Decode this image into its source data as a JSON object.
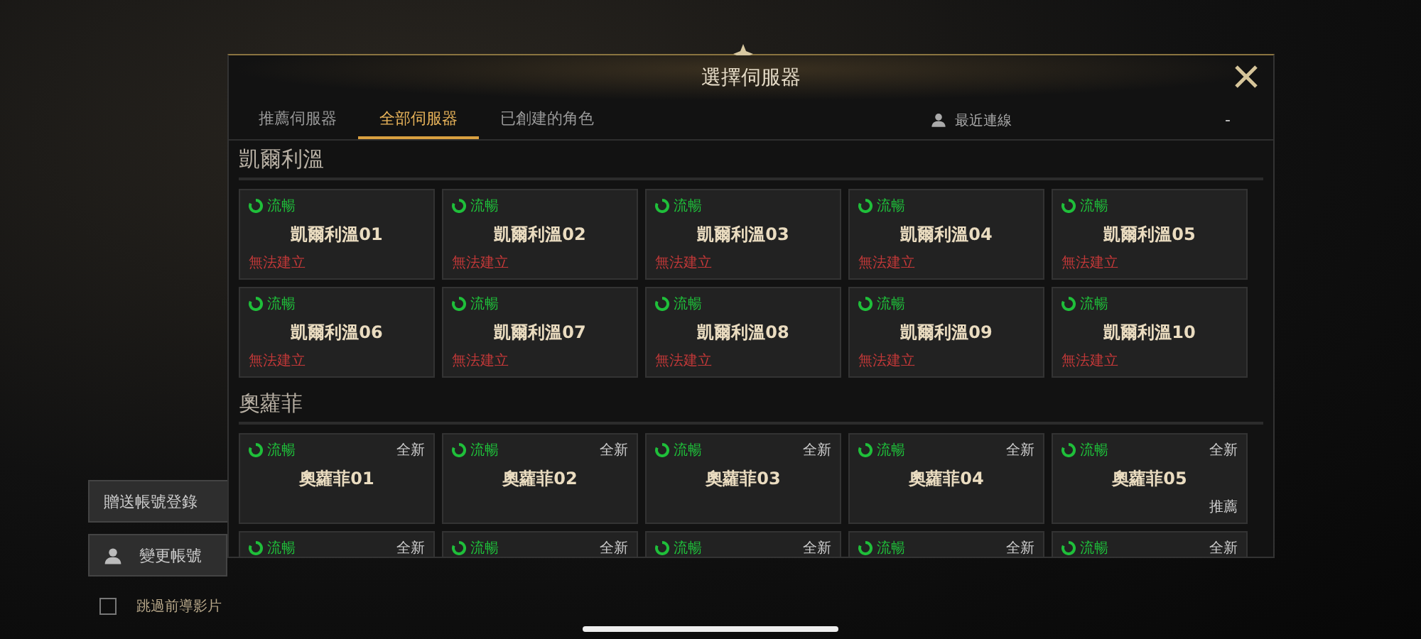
{
  "dialog": {
    "title": "選擇伺服器"
  },
  "tabs": [
    {
      "label": "推薦伺服器",
      "selected": false
    },
    {
      "label": "全部伺服器",
      "selected": true
    },
    {
      "label": "已創建的角色",
      "selected": false
    }
  ],
  "recent": {
    "label": "最近連線",
    "value": "-"
  },
  "sections": [
    {
      "title": "凱爾利溫",
      "servers": [
        {
          "status": "流暢",
          "name": "凱爾利溫01",
          "note": "無法建立"
        },
        {
          "status": "流暢",
          "name": "凱爾利溫02",
          "note": "無法建立"
        },
        {
          "status": "流暢",
          "name": "凱爾利溫03",
          "note": "無法建立"
        },
        {
          "status": "流暢",
          "name": "凱爾利溫04",
          "note": "無法建立"
        },
        {
          "status": "流暢",
          "name": "凱爾利溫05",
          "note": "無法建立"
        },
        {
          "status": "流暢",
          "name": "凱爾利溫06",
          "note": "無法建立"
        },
        {
          "status": "流暢",
          "name": "凱爾利溫07",
          "note": "無法建立"
        },
        {
          "status": "流暢",
          "name": "凱爾利溫08",
          "note": "無法建立"
        },
        {
          "status": "流暢",
          "name": "凱爾利溫09",
          "note": "無法建立"
        },
        {
          "status": "流暢",
          "name": "凱爾利溫10",
          "note": "無法建立"
        }
      ]
    },
    {
      "title": "奧蘿菲",
      "servers": [
        {
          "status": "流暢",
          "tag": "全新",
          "name": "奧蘿菲01"
        },
        {
          "status": "流暢",
          "tag": "全新",
          "name": "奧蘿菲02"
        },
        {
          "status": "流暢",
          "tag": "全新",
          "name": "奧蘿菲03"
        },
        {
          "status": "流暢",
          "tag": "全新",
          "name": "奧蘿菲04"
        },
        {
          "status": "流暢",
          "tag": "全新",
          "name": "奧蘿菲05",
          "badge": "推薦"
        },
        {
          "status": "流暢",
          "tag": "全新"
        },
        {
          "status": "流暢",
          "tag": "全新"
        },
        {
          "status": "流暢",
          "tag": "全新"
        },
        {
          "status": "流暢",
          "tag": "全新"
        },
        {
          "status": "流暢",
          "tag": "全新"
        }
      ]
    }
  ],
  "side_buttons": [
    {
      "label": "贈送帳號登錄",
      "kind": "plain"
    },
    {
      "label": "變更帳號",
      "kind": "account"
    }
  ],
  "skip_video": {
    "label": "跳過前導影片",
    "checked": false
  }
}
